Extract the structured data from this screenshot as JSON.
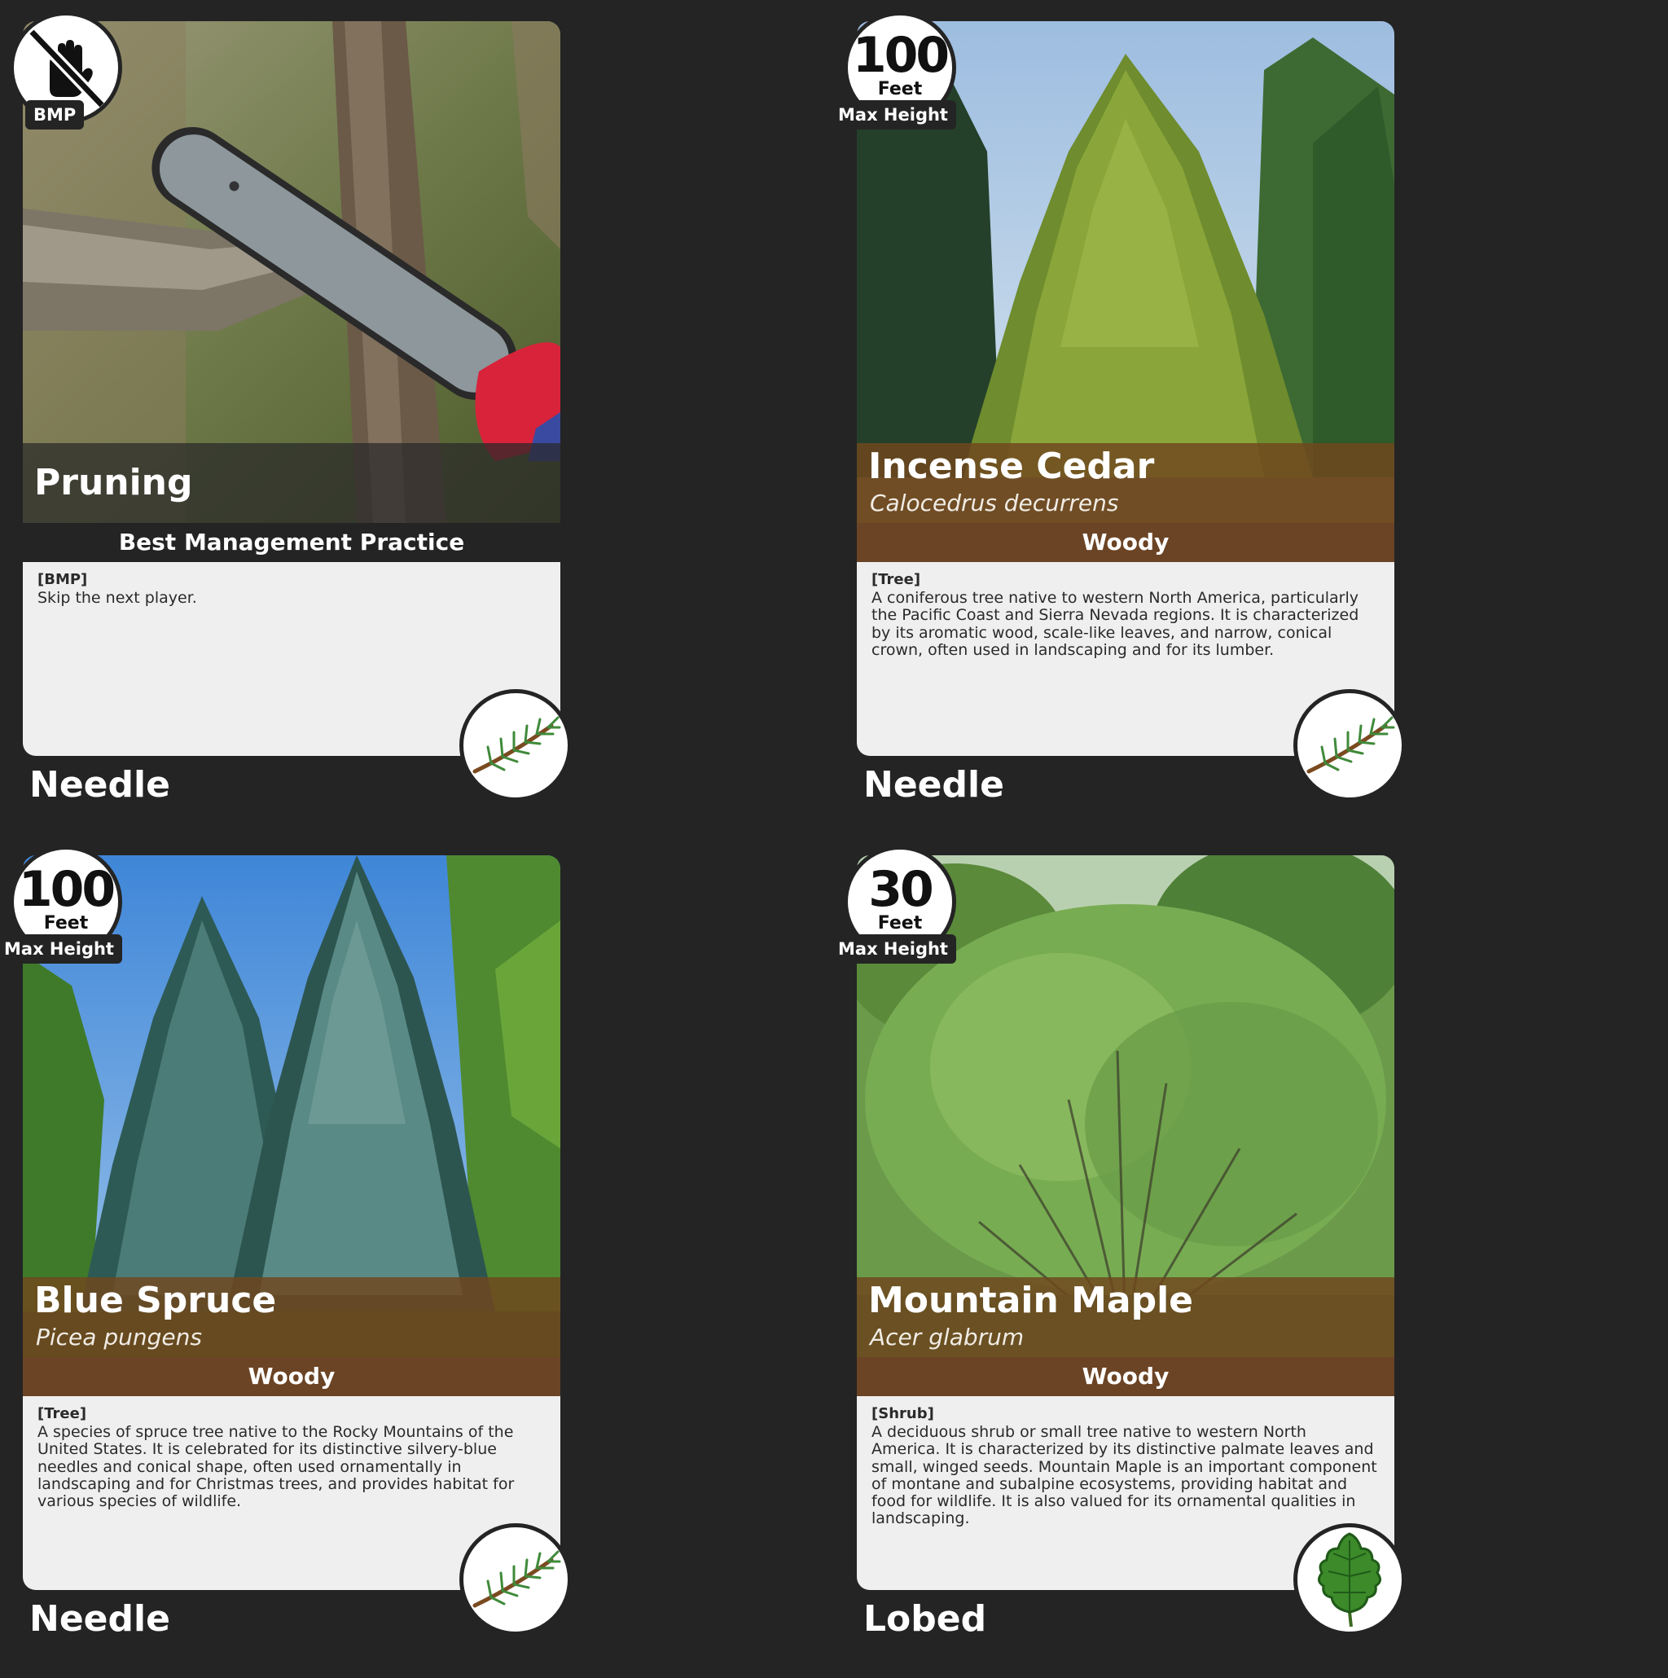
{
  "cards": [
    {
      "kind": "bmp",
      "badge_label": "BMP",
      "badge_icon": "no-hand-icon",
      "name": "Pruning",
      "type_label": "Best Management Practice",
      "desc_tag": "[BMP]",
      "description": "Skip the next player.",
      "leaf_type": "Needle",
      "leaf_icon": "needle-icon"
    },
    {
      "kind": "plant",
      "height_value": "100",
      "height_unit": "Feet",
      "height_label": "Max Height",
      "name": "Incense Cedar",
      "scientific_name": "Calocedrus decurrens",
      "type_label": "Woody",
      "desc_tag": "[Tree]",
      "description": "A coniferous tree native to western North America, particularly the Pacific Coast and Sierra Nevada regions. It is characterized by its aromatic wood, scale-like leaves, and narrow, conical crown, often used in landscaping and for its lumber.",
      "leaf_type": "Needle",
      "leaf_icon": "needle-icon"
    },
    {
      "kind": "plant",
      "height_value": "100",
      "height_unit": "Feet",
      "height_label": "Max Height",
      "name": "Blue Spruce",
      "scientific_name": "Picea pungens",
      "type_label": "Woody",
      "desc_tag": "[Tree]",
      "description": "A species of spruce tree native to the Rocky Mountains of the United States. It is celebrated for its distinctive silvery-blue needles and conical shape, often used ornamentally in landscaping and for Christmas trees, and provides habitat for various species of wildlife.",
      "leaf_type": "Needle",
      "leaf_icon": "needle-icon"
    },
    {
      "kind": "plant",
      "height_value": "30",
      "height_unit": "Feet",
      "height_label": "Max Height",
      "name": "Mountain Maple",
      "scientific_name": "Acer glabrum",
      "type_label": "Woody",
      "desc_tag": "[Shrub]",
      "description": "A deciduous shrub or small tree native to western North America. It is characterized by its distinctive palmate leaves and small, winged seeds. Mountain Maple is an important component of montane and subalpine ecosystems, providing habitat and food for wildlife. It is also valued for its ornamental qualities in landscaping.",
      "leaf_type": "Lobed",
      "leaf_icon": "lobed-leaf-icon"
    }
  ],
  "colors": {
    "background": "#242424",
    "woody_bar": "#6b4425",
    "name_overlay": "#70481e",
    "desc_panel": "#efefef"
  }
}
